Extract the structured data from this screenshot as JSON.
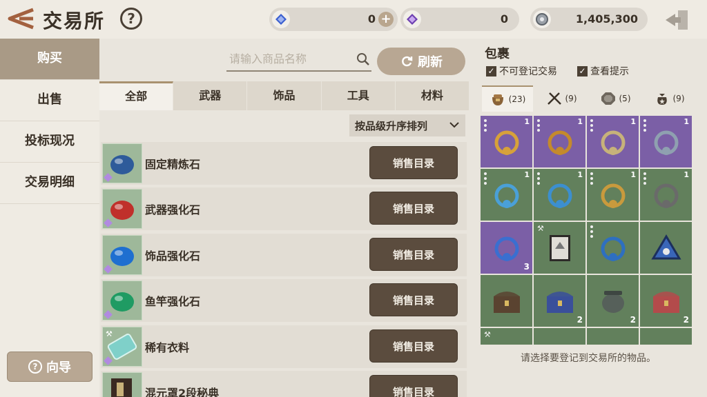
{
  "header": {
    "title": "交易所",
    "help_symbol": "?",
    "currencies": [
      {
        "name": "blue-gem",
        "value": "0",
        "color": "#3a5fd0"
      },
      {
        "name": "purple-gem",
        "value": "0",
        "color": "#6d3fb0"
      },
      {
        "name": "silver-coin",
        "value": "1,405,300",
        "color": "#8a8f96"
      }
    ],
    "plus_symbol": "+"
  },
  "nav": {
    "items": [
      {
        "label": "购买",
        "active": true
      },
      {
        "label": "出售",
        "active": false
      },
      {
        "label": "投标现况",
        "active": false
      },
      {
        "label": "交易明细",
        "active": false
      }
    ],
    "guide_label": "向导",
    "guide_symbol": "?"
  },
  "market": {
    "search_placeholder": "请输入商品名称",
    "refresh_label": "刷新",
    "tabs": [
      "全部",
      "武器",
      "饰品",
      "工具",
      "材料"
    ],
    "active_tab": 0,
    "sort_label": "按品级升序排列",
    "sell_label": "销售目录",
    "items": [
      {
        "name": "固定精炼石",
        "icon": "dark-blue-refining-stone",
        "icon_color": "#2e5b9a",
        "mark": "gem"
      },
      {
        "name": "武器强化石",
        "icon": "red-enhance-stone",
        "icon_color": "#c0302b",
        "mark": "gem"
      },
      {
        "name": "饰品强化石",
        "icon": "blue-enhance-stone",
        "icon_color": "#1f6fd0",
        "mark": "gem"
      },
      {
        "name": "鱼竿强化石",
        "icon": "green-enhance-stone",
        "icon_color": "#1f9b63",
        "mark": "gem"
      },
      {
        "name": "稀有衣料",
        "icon": "cloth-bundle",
        "icon_color": "#7fd0c9",
        "mark": "tool"
      },
      {
        "name": "混元罩2段秘典",
        "icon": "secret-book",
        "icon_color": "#3b2a22",
        "mark": "none"
      }
    ]
  },
  "bag": {
    "title": "包裹",
    "checks": [
      {
        "label": "不可登记交易",
        "checked": true
      },
      {
        "label": "查看提示",
        "checked": true
      }
    ],
    "categories": [
      {
        "icon": "bag-icon",
        "count": "(23)",
        "active": true
      },
      {
        "icon": "weapon-icon",
        "count": "(9)",
        "active": false
      },
      {
        "icon": "accessory-icon",
        "count": "(5)",
        "active": false
      },
      {
        "icon": "material-icon",
        "count": "(9)",
        "active": false
      }
    ],
    "hint": "请选择要登记到交易所的物品。",
    "cells": [
      {
        "icon": "amulet-necklace",
        "bg": "purple",
        "count": "1",
        "count_pos": "top",
        "dots": true
      },
      {
        "icon": "pendant-earring",
        "bg": "purple",
        "count": "1",
        "count_pos": "top",
        "dots": true
      },
      {
        "icon": "gold-ring",
        "bg": "purple",
        "count": "1",
        "count_pos": "top",
        "dots": true
      },
      {
        "icon": "bead-bracelet",
        "bg": "purple",
        "count": "1",
        "count_pos": "top",
        "dots": true
      },
      {
        "icon": "blue-earring",
        "bg": "green",
        "count": "1",
        "count_pos": "top",
        "dots": true
      },
      {
        "icon": "blue-bracelet",
        "bg": "green",
        "count": "1",
        "count_pos": "top",
        "dots": true
      },
      {
        "icon": "gold-necklace",
        "bg": "green",
        "count": "1",
        "count_pos": "top",
        "dots": true
      },
      {
        "icon": "compass-amulet",
        "bg": "green",
        "count": "1",
        "count_pos": "top",
        "dots": true
      },
      {
        "icon": "blue-orb",
        "bg": "purple",
        "count": "3",
        "count_pos": "bottom",
        "dots": false
      },
      {
        "icon": "framed-stone",
        "bg": "green",
        "count": "",
        "count_pos": "top",
        "dots": false,
        "wrench": true
      },
      {
        "icon": "chain-pendant",
        "bg": "green",
        "count": "",
        "count_pos": "top",
        "dots": true
      },
      {
        "icon": "blue-triangle-charm",
        "bg": "green",
        "count": "",
        "count_pos": "top",
        "dots": false
      },
      {
        "icon": "wooden-chest",
        "bg": "green",
        "count": "",
        "count_pos": "top",
        "dots": false
      },
      {
        "icon": "blue-chest",
        "bg": "green",
        "count": "2",
        "count_pos": "bottom",
        "dots": false
      },
      {
        "icon": "iron-cauldron",
        "bg": "green",
        "count": "2",
        "count_pos": "bottom",
        "dots": false
      },
      {
        "icon": "flower-chest",
        "bg": "green",
        "count": "2",
        "count_pos": "bottom",
        "dots": false
      },
      {
        "icon": "partial-item",
        "bg": "green",
        "count": "",
        "count_pos": "top",
        "dots": false,
        "wrench": true
      },
      {
        "icon": "partial-item",
        "bg": "green",
        "count": "",
        "count_pos": "top",
        "dots": false
      },
      {
        "icon": "partial-item",
        "bg": "green",
        "count": "",
        "count_pos": "top",
        "dots": false
      },
      {
        "icon": "partial-item",
        "bg": "green",
        "count": "",
        "count_pos": "top",
        "dots": false
      }
    ]
  }
}
